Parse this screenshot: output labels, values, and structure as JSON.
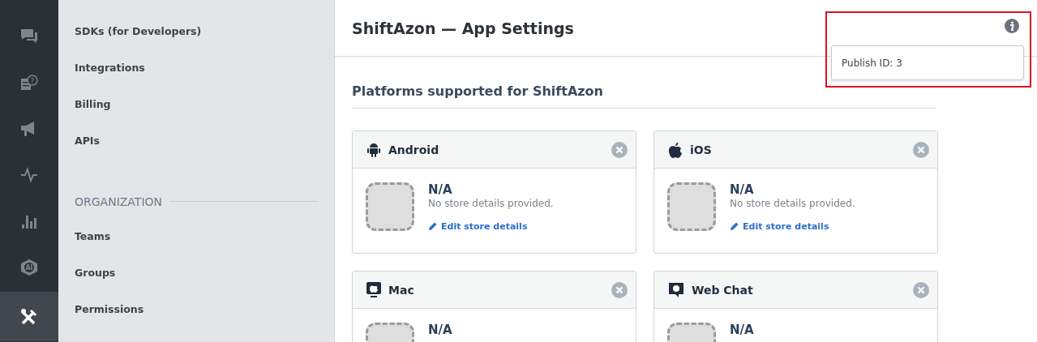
{
  "rail": [
    {
      "kind": "chat",
      "selected": false
    },
    {
      "kind": "help",
      "selected": false,
      "glyph": "?"
    },
    {
      "kind": "megaphone",
      "selected": false
    },
    {
      "kind": "pulse",
      "selected": false
    },
    {
      "kind": "chart",
      "selected": false
    },
    {
      "kind": "ai",
      "selected": false,
      "glyph": "AI"
    },
    {
      "kind": "tools",
      "selected": true
    }
  ],
  "submenu": {
    "items": [
      "SDKs (for Developers)",
      "Integrations",
      "Billing",
      "APIs"
    ],
    "section": "ORGANIZATION",
    "section_items": [
      "Teams",
      "Groups",
      "Permissions"
    ]
  },
  "header": {
    "title": "ShiftAzon — App Settings"
  },
  "popover": {
    "text": "Publish ID: 3",
    "highlighted": true
  },
  "section_title": "Platforms supported for ShiftAzon",
  "platforms": [
    {
      "kind": "android",
      "name": "Android",
      "store_name": "N/A",
      "description": "No store details provided.",
      "link": "Edit store details"
    },
    {
      "kind": "ios",
      "name": "iOS",
      "store_name": "N/A",
      "description": "No store details provided.",
      "link": "Edit store details"
    },
    {
      "kind": "mac",
      "name": "Mac",
      "store_name": "N/A"
    },
    {
      "kind": "webchat",
      "name": "Web Chat",
      "store_name": "N/A"
    }
  ]
}
